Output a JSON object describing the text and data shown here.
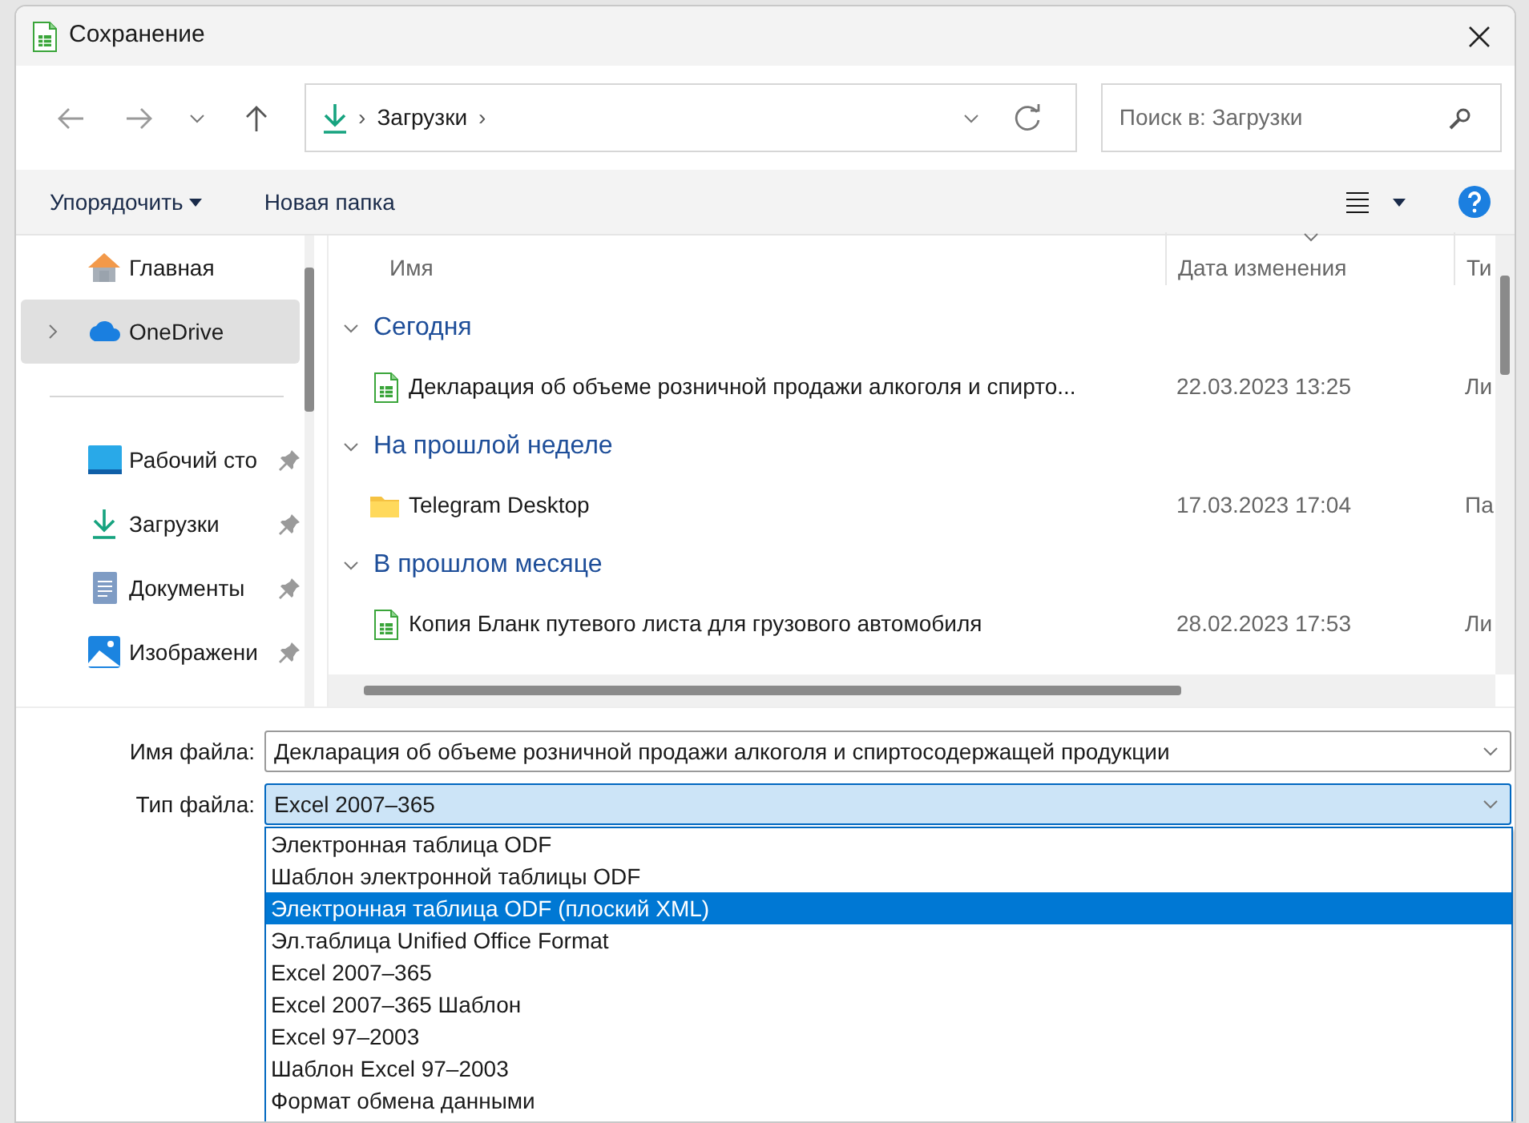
{
  "window": {
    "title": "Сохранение"
  },
  "address_bar": {
    "separator_before": "›",
    "location": "Загрузки",
    "separator_after": "›"
  },
  "search": {
    "placeholder": "Поиск в: Загрузки"
  },
  "command_bar": {
    "organize": "Упорядочить",
    "new_folder": "Новая папка"
  },
  "sidebar": {
    "items": [
      {
        "label": "Главная",
        "selected": false,
        "expandable": false,
        "pinned": false
      },
      {
        "label": "OneDrive",
        "selected": true,
        "expandable": true,
        "pinned": false
      },
      {
        "label": "Рабочий сто",
        "selected": false,
        "expandable": false,
        "pinned": true
      },
      {
        "label": "Загрузки",
        "selected": false,
        "expandable": false,
        "pinned": true
      },
      {
        "label": "Документы",
        "selected": false,
        "expandable": false,
        "pinned": true
      },
      {
        "label": "Изображени",
        "selected": false,
        "expandable": false,
        "pinned": true
      }
    ]
  },
  "file_list": {
    "columns": [
      {
        "label": "Имя",
        "sorted": false
      },
      {
        "label": "Дата изменения",
        "sorted": true
      },
      {
        "label": "Ти",
        "sorted": false
      }
    ],
    "groups": [
      {
        "title": "Сегодня",
        "expanded": true,
        "items": [
          {
            "kind": "spreadsheet",
            "name": "Декларация об объеме розничной продажи алкоголя и спирто...",
            "date": "22.03.2023 13:25",
            "type": "Ли"
          }
        ]
      },
      {
        "title": "На прошлой неделе",
        "expanded": true,
        "items": [
          {
            "kind": "folder",
            "name": "Telegram Desktop",
            "date": "17.03.2023 17:04",
            "type": "Па"
          }
        ]
      },
      {
        "title": "В прошлом месяце",
        "expanded": true,
        "items": [
          {
            "kind": "spreadsheet",
            "name": "Копия Бланк путевого листа для грузового автомобиля",
            "date": "28.02.2023 17:53",
            "type": "Ли"
          }
        ]
      }
    ]
  },
  "save_form": {
    "file_name_label": "Имя файла:",
    "file_name": "Декларация об объеме розничной продажи алкоголя и спиртосодержащей продукции",
    "file_type_label": "Тип файла:",
    "file_type": "Excel 2007–365",
    "file_type_options": [
      {
        "label": "Электронная таблица ODF",
        "selected": false
      },
      {
        "label": "Шаблон электронной таблицы ODF",
        "selected": false
      },
      {
        "label": "Электронная таблица ODF (плоский XML)",
        "selected": true
      },
      {
        "label": "Эл.таблица Unified Office Format",
        "selected": false
      },
      {
        "label": "Excel 2007–365",
        "selected": false
      },
      {
        "label": "Excel 2007–365 Шаблон",
        "selected": false
      },
      {
        "label": "Excel 97–2003",
        "selected": false
      },
      {
        "label": "Шаблон Excel 97–2003",
        "selected": false
      },
      {
        "label": "Формат обмена данными",
        "selected": false
      }
    ]
  }
}
